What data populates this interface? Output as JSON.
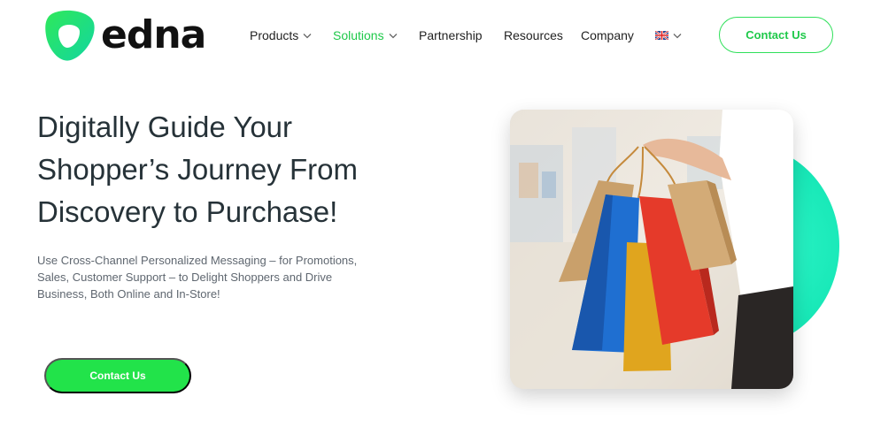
{
  "brand": {
    "name": "edna"
  },
  "nav": {
    "items": [
      {
        "label": "Products",
        "has_dropdown": true,
        "active": false
      },
      {
        "label": "Solutions",
        "has_dropdown": true,
        "active": true
      },
      {
        "label": "Partnership",
        "has_dropdown": false,
        "active": false
      },
      {
        "label": "Resources",
        "has_dropdown": false,
        "active": false
      },
      {
        "label": "Company",
        "has_dropdown": false,
        "active": false
      }
    ],
    "language_icon": "uk-flag-icon",
    "contact_label": "Contact Us"
  },
  "hero": {
    "title": "Digitally Guide Your Shopper’s Journey From Discovery to Purchase!",
    "subtitle": "Use Cross-Channel Personalized Messaging – for Promotions, Sales, Customer Support – to Delight Shoppers and Drive Business, Both Online and In-Store!",
    "cta_label": "Contact Us",
    "image_alt_icon": "shopping-bags-photo"
  },
  "colors": {
    "accent_green": "#22e34a",
    "active_nav": "#1fc94a",
    "teal": "#16e7b6",
    "heading": "#263238"
  }
}
